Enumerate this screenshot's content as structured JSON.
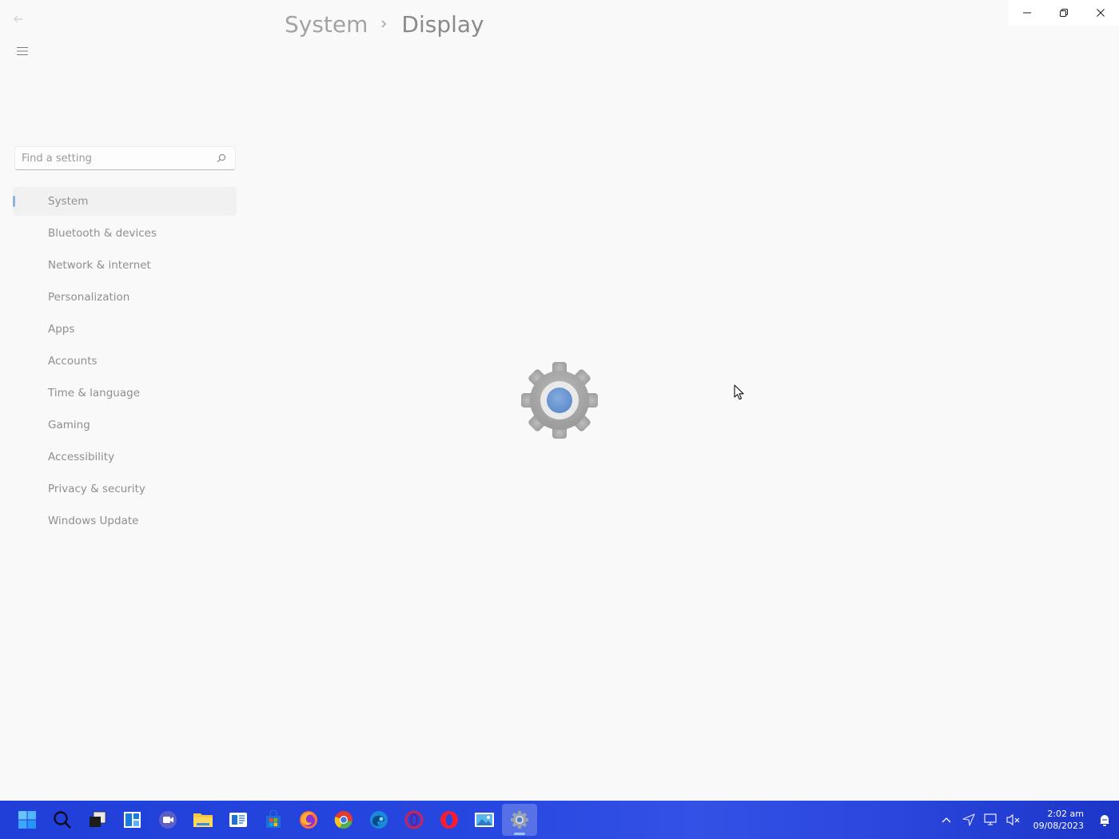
{
  "window": {
    "breadcrumb": {
      "root": "System",
      "current": "Display"
    },
    "controls": {
      "minimize_icon": "minimize-icon",
      "restore_icon": "restore-icon",
      "close_icon": "close-icon"
    }
  },
  "search": {
    "placeholder": "Find a setting"
  },
  "nav": {
    "items": [
      {
        "label": "System",
        "active": true
      },
      {
        "label": "Bluetooth & devices"
      },
      {
        "label": "Network & internet"
      },
      {
        "label": "Personalization"
      },
      {
        "label": "Apps"
      },
      {
        "label": "Accounts"
      },
      {
        "label": "Time & language"
      },
      {
        "label": "Gaming"
      },
      {
        "label": "Accessibility"
      },
      {
        "label": "Privacy & security"
      },
      {
        "label": "Windows Update"
      }
    ]
  },
  "taskbar": {
    "apps": [
      "start-icon",
      "search-icon",
      "task-view-icon",
      "widgets-icon",
      "meet-icon",
      "file-explorer-icon",
      "news-icon",
      "store-icon",
      "firefox-icon",
      "chrome-icon",
      "edge-dev-icon",
      "opera-gx-icon",
      "opera-icon",
      "photos-icon",
      "settings-icon"
    ],
    "active_app": "settings-icon",
    "tray": [
      "chevron-up-icon",
      "location-icon",
      "network-icon",
      "volume-muted-icon"
    ],
    "clock": {
      "time": "2:02 am",
      "date": "09/08/2023"
    },
    "notification_icon": "notification-icon"
  },
  "colors": {
    "accent": "#0067c0",
    "taskbar": "#2748e0",
    "splash_gear": "#a6a6a6",
    "splash_center": "#6f9ad6"
  }
}
